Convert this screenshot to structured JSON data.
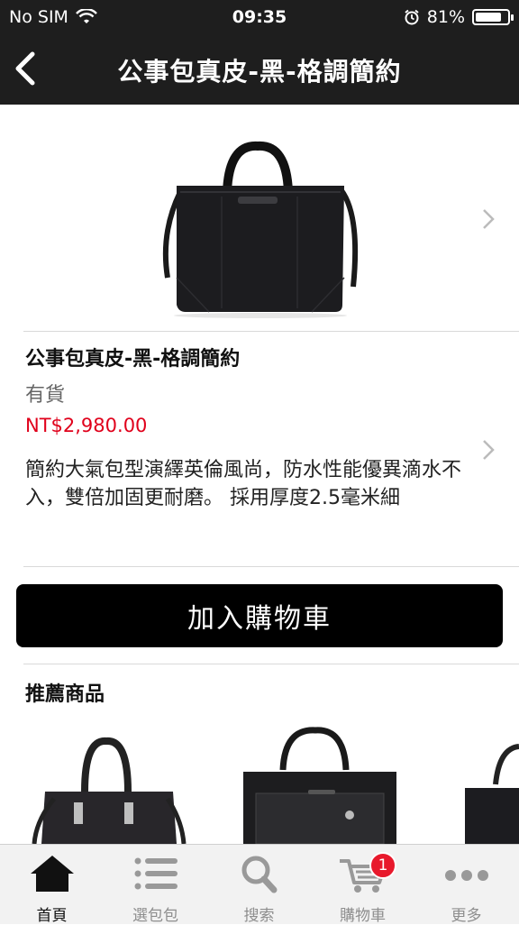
{
  "status_bar": {
    "carrier": "No SIM",
    "time": "09:35",
    "battery_text": "81%",
    "battery_level": 0.81
  },
  "nav": {
    "title": "公事包真皮-黑-格調簡約",
    "back_icon": "chevron-left-icon"
  },
  "product": {
    "name": "公事包真皮-黑-格調簡約",
    "stock": "有貨",
    "price": "NT$2,980.00",
    "description": "簡約大氣包型演繹英倫風尚，防水性能優異滴水不入，雙倍加固更耐磨。 採用厚度2.5毫米細"
  },
  "actions": {
    "add_to_cart": "加入購物車"
  },
  "recommended": {
    "title": "推薦商品"
  },
  "tabbar": {
    "tabs": [
      {
        "label": "首頁",
        "icon": "home-icon"
      },
      {
        "label": "選包包",
        "icon": "list-icon"
      },
      {
        "label": "搜索",
        "icon": "search-icon"
      },
      {
        "label": "購物車",
        "icon": "cart-icon"
      },
      {
        "label": "更多",
        "icon": "more-icon"
      }
    ],
    "cart_badge": "1"
  },
  "colors": {
    "header_bg": "#1e1e1e",
    "price": "#e0001b",
    "badge": "#e8192c",
    "button_bg": "#000000"
  }
}
